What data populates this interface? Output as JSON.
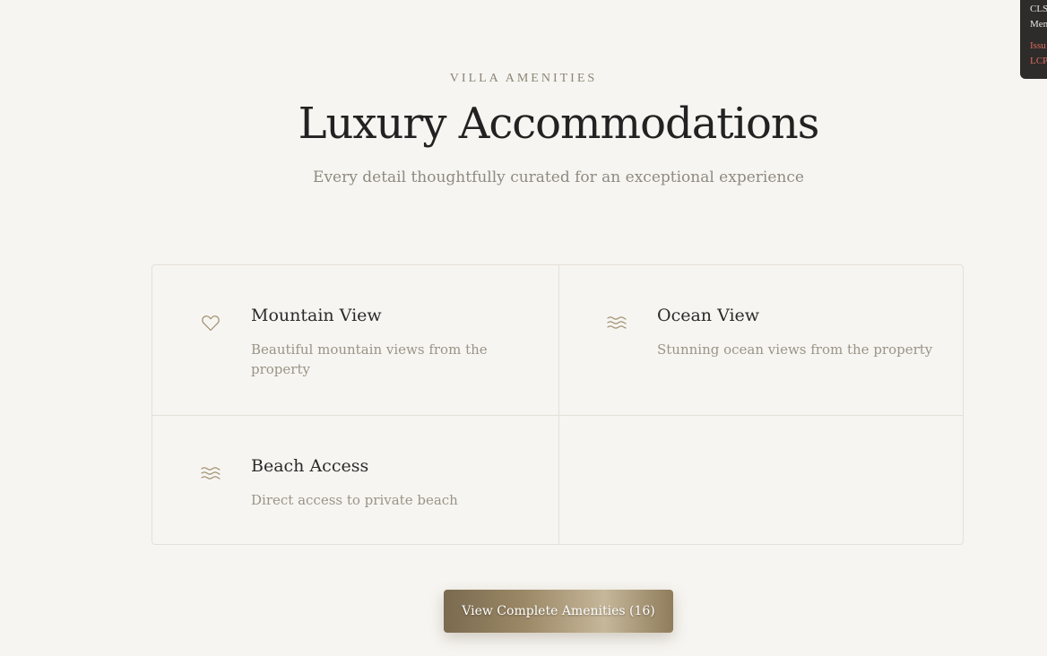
{
  "header": {
    "eyebrow": "VILLA AMENITIES",
    "title": "Luxury Accommodations",
    "subtitle": "Every detail thoughtfully curated for an exceptional experience"
  },
  "amenities": [
    {
      "name": "Mountain View",
      "description": "Beautiful mountain views from the property",
      "icon": "heart-icon"
    },
    {
      "name": "Ocean View",
      "description": "Stunning ocean views from the property",
      "icon": "waves-icon"
    },
    {
      "name": "Beach Access",
      "description": "Direct access to private beach",
      "icon": "waves-icon"
    }
  ],
  "cta": {
    "label": "View Complete Amenities (16)"
  },
  "debug_panel": {
    "line1": "CLS",
    "line2": "Mem",
    "line3": "Issu",
    "line4": "LCP"
  },
  "colors": {
    "background": "#f7f5f1",
    "icon_accent": "#a08f70",
    "cta_gold": "#9b8866",
    "warning": "#e06b5a"
  }
}
